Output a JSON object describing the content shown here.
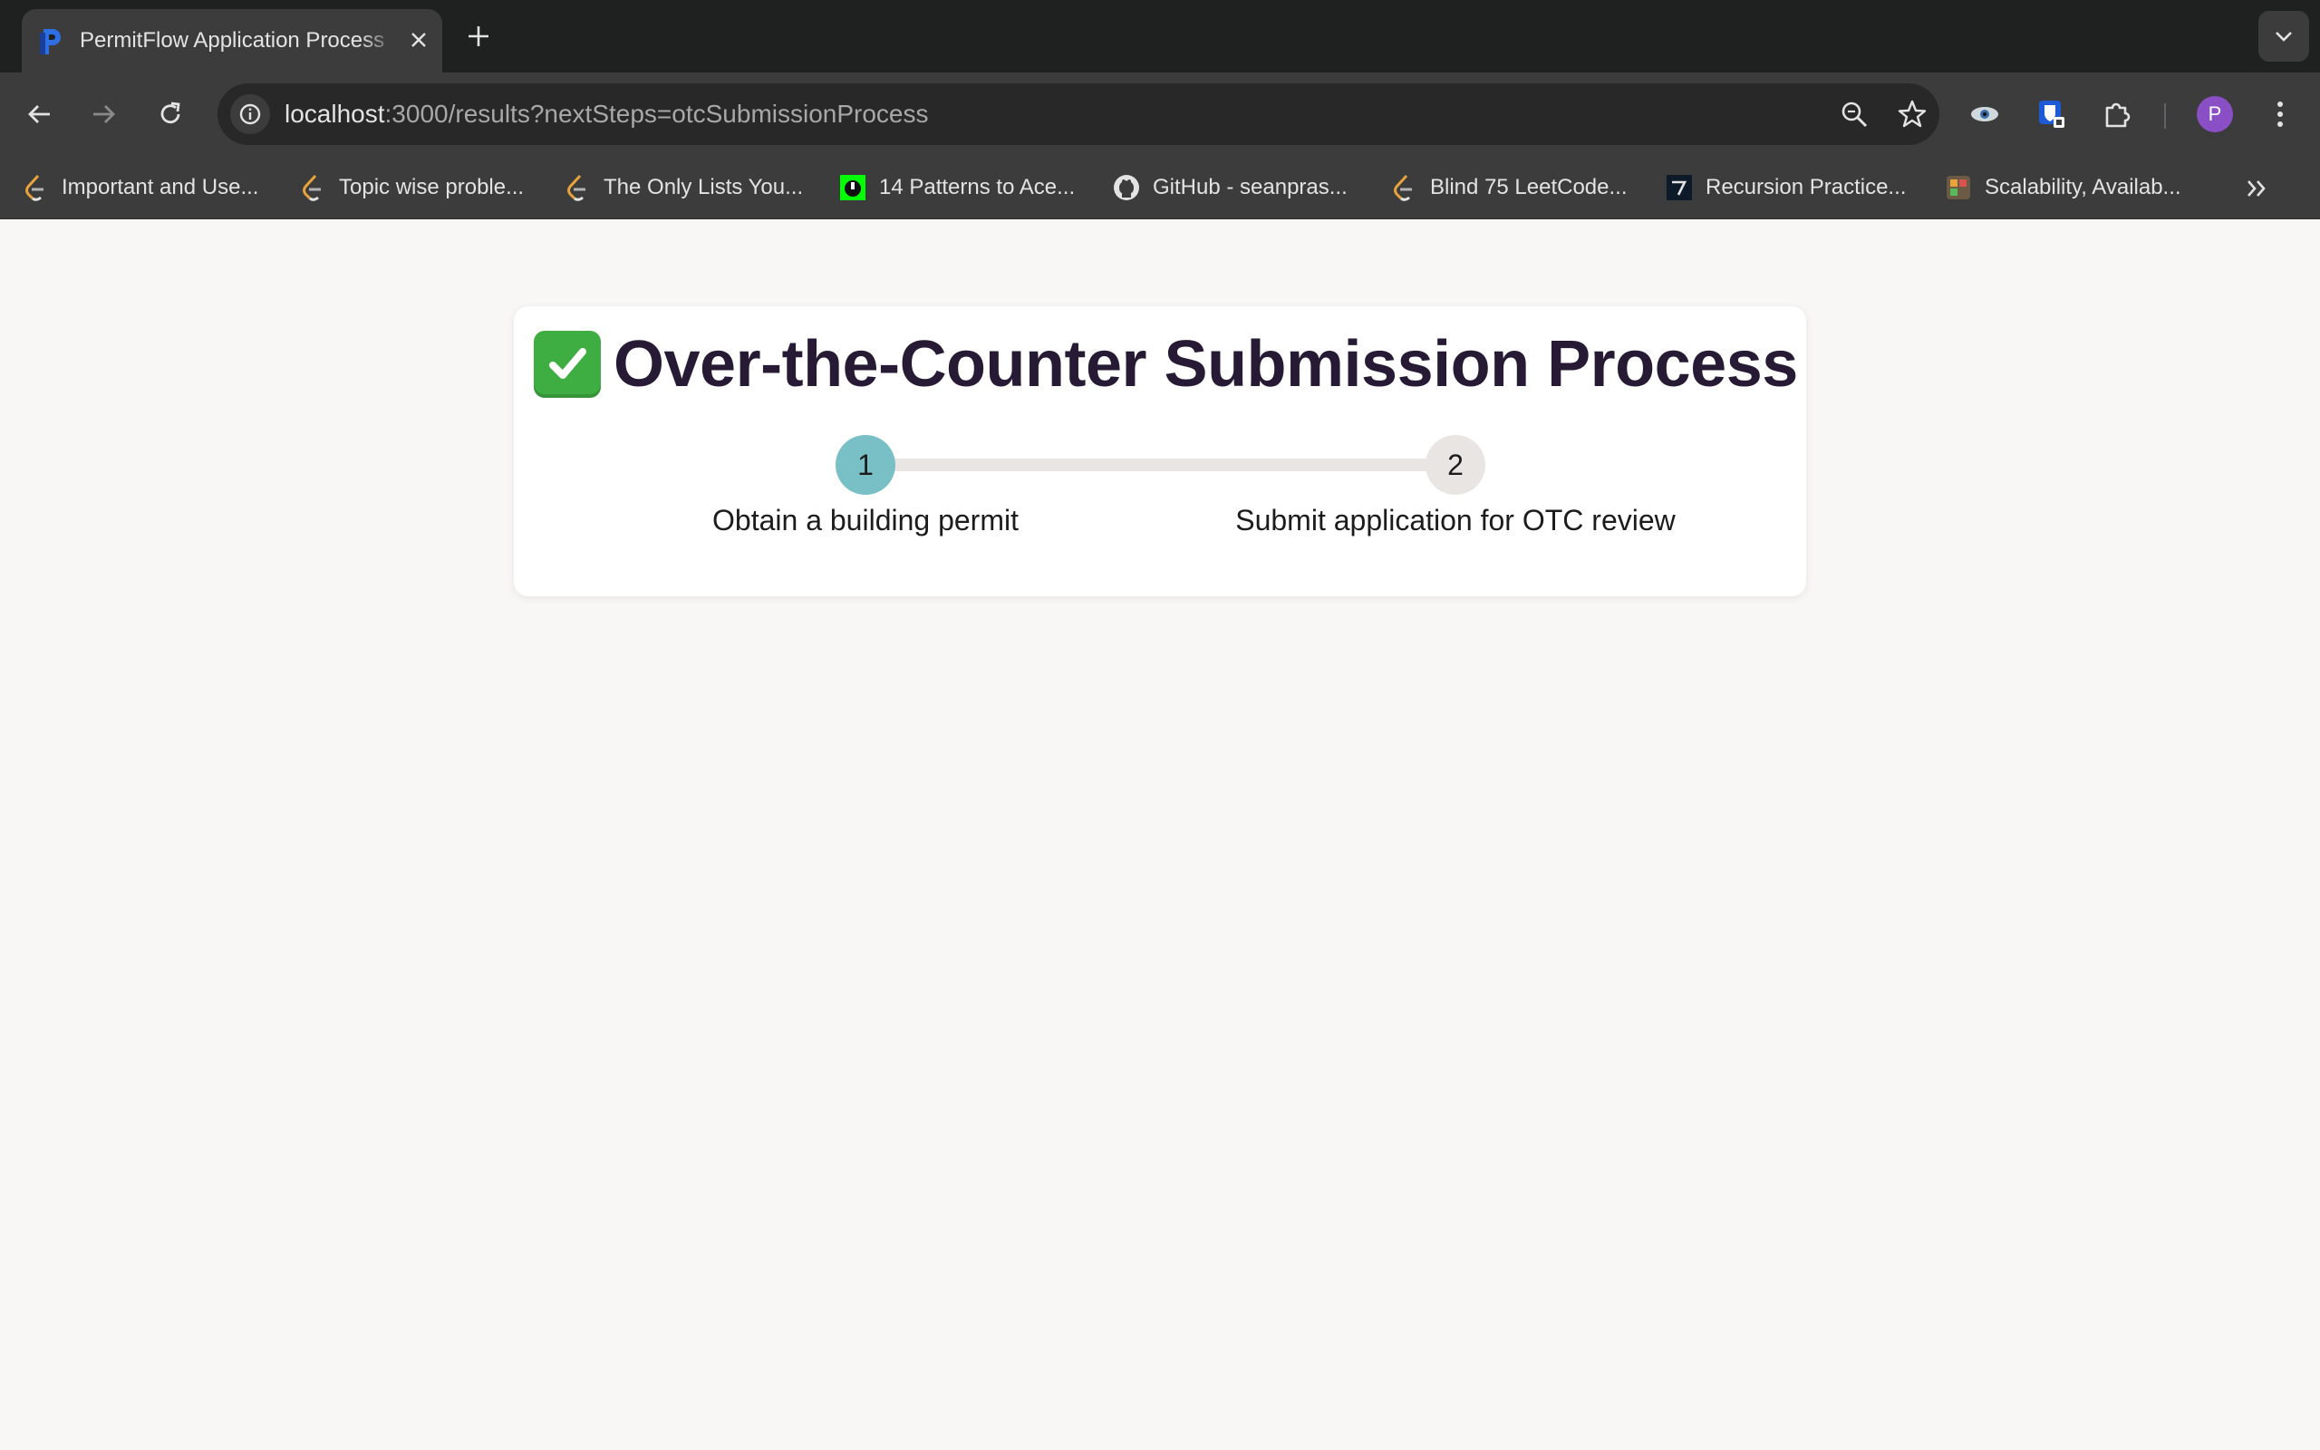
{
  "browser": {
    "tab": {
      "title": "PermitFlow Application Process"
    },
    "url": {
      "host": "localhost",
      "path": ":3000/results?nextSteps=otcSubmissionProcess"
    },
    "profile_initial": "P",
    "bookmarks": [
      {
        "label": "Important and Use...",
        "icon": "leetcode-icon"
      },
      {
        "label": "Topic wise proble...",
        "icon": "leetcode-icon"
      },
      {
        "label": "The Only Lists You...",
        "icon": "leetcode-icon"
      },
      {
        "label": "14 Patterns to Ace...",
        "icon": "hackernoon-icon"
      },
      {
        "label": "GitHub - seanpras...",
        "icon": "github-icon"
      },
      {
        "label": "Blind 75 LeetCode...",
        "icon": "leetcode-icon"
      },
      {
        "label": "Recursion Practice...",
        "icon": "site-icon"
      },
      {
        "label": "Scalability, Availab...",
        "icon": "site-icon"
      }
    ]
  },
  "page": {
    "title": "Over-the-Counter Submission Process",
    "steps": [
      {
        "number": "1",
        "label": "Obtain a building permit",
        "state": "active"
      },
      {
        "number": "2",
        "label": "Submit application for OTC review",
        "state": "inactive"
      }
    ]
  },
  "colors": {
    "title": "#261a35",
    "step_active": "#79bfc6",
    "step_inactive": "#e9e5e2",
    "page_bg": "#f9f7f6"
  }
}
